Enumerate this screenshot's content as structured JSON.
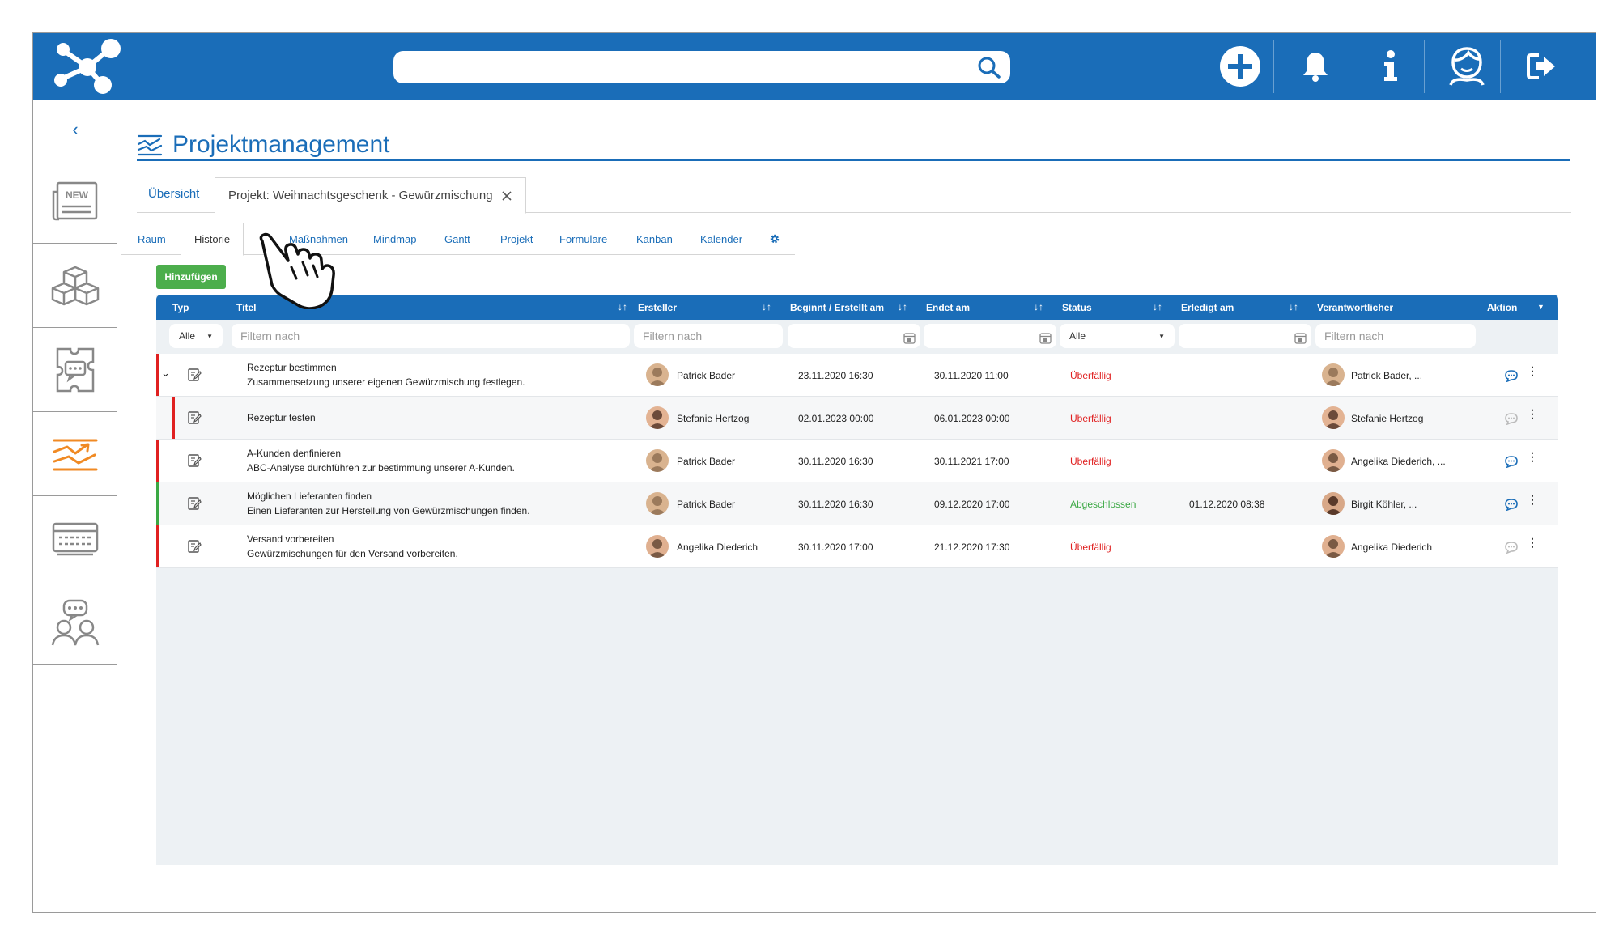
{
  "app": {
    "search": {
      "placeholder": "",
      "value": ""
    },
    "top_icons": [
      "plus-circle-icon",
      "bell-icon",
      "info-icon",
      "user-avatar-icon",
      "logout-icon"
    ]
  },
  "sidebar": {
    "items": [
      {
        "id": "news",
        "icon": "news-icon",
        "badge": "NEW"
      },
      {
        "id": "modules",
        "icon": "cubes-icon"
      },
      {
        "id": "knowledge",
        "icon": "puzzle-chat-icon"
      },
      {
        "id": "projects",
        "icon": "chart-trend-icon",
        "active": true
      },
      {
        "id": "board",
        "icon": "keyboard-board-icon"
      },
      {
        "id": "community",
        "icon": "people-chat-icon"
      }
    ]
  },
  "page": {
    "title": "Projektmanagement"
  },
  "primary_tabs": {
    "overview": "Übersicht",
    "project": "Projekt: Weihnachtsgeschenk - Gewürzmischung"
  },
  "sub_tabs": [
    "Raum",
    "Historie",
    "Maßnahmen",
    "Mindmap",
    "Gantt",
    "Projekt",
    "Formulare",
    "Kanban",
    "Kalender"
  ],
  "add_button": "Hinzufügen",
  "table": {
    "columns": {
      "typ": "Typ",
      "titel": "Titel",
      "ersteller": "Ersteller",
      "beginnt": "Beginnt / Erstellt am",
      "endet": "Endet am",
      "status": "Status",
      "erledigt": "Erledigt am",
      "verantwortlicher": "Verantwortlicher",
      "aktion": "Aktion"
    },
    "filters": {
      "typ": "Alle",
      "titel": "Filtern nach",
      "ersteller": "Filtern nach",
      "status": "Alle",
      "verantwortlicher": "Filtern nach"
    },
    "rows": [
      {
        "title": "Rezeptur bestimmen",
        "subtitle": "Zusammensetzung unserer eigenen Gewürzmischung festlegen.",
        "creator": "Patrick Bader",
        "start": "23.11.2020 16:30",
        "end": "30.11.2020 11:00",
        "status": "Überfällig",
        "done": "",
        "responsible": "Patrick Bader, ...",
        "status_color": "#e02020",
        "expanded": true
      },
      {
        "title": "Rezeptur testen",
        "subtitle": "",
        "creator": "Stefanie Hertzog",
        "start": "02.01.2023 00:00",
        "end": "06.01.2023 00:00",
        "status": "Überfällig",
        "done": "",
        "responsible": "Stefanie Hertzog",
        "status_color": "#e02020",
        "child": true
      },
      {
        "title": "A-Kunden denfinieren",
        "subtitle": "ABC-Analyse durchführen zur bestimmung unserer A-Kunden.",
        "creator": "Patrick Bader",
        "start": "30.11.2020 16:30",
        "end": "30.11.2021 17:00",
        "status": "Überfällig",
        "done": "",
        "responsible": "Angelika Diederich, ...",
        "status_color": "#e02020"
      },
      {
        "title": "Möglichen Lieferanten finden",
        "subtitle": "Einen Lieferanten zur Herstellung von Gewürzmischungen finden.",
        "creator": "Patrick Bader",
        "start": "30.11.2020 16:30",
        "end": "09.12.2020 17:00",
        "status": "Abgeschlossen",
        "done": "01.12.2020 08:38",
        "responsible": "Birgit Köhler, ...",
        "status_color": "#3aa843"
      },
      {
        "title": "Versand vorbereiten",
        "subtitle": "Gewürzmischungen für den Versand vorbereiten.",
        "creator": "Angelika Diederich",
        "start": "30.11.2020 17:00",
        "end": "21.12.2020 17:30",
        "status": "Überfällig",
        "done": "",
        "responsible": "Angelika Diederich",
        "status_color": "#e02020"
      }
    ]
  },
  "colors": {
    "brand": "#1a6db8",
    "overdue": "#e02020",
    "done": "#3aa843",
    "add_button": "#4cae4c",
    "sidebar_active": "#f08a24"
  }
}
